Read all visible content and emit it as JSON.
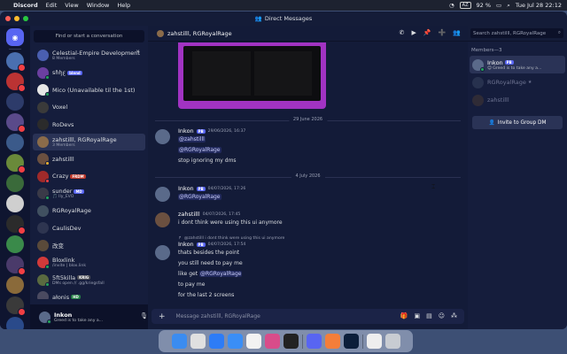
{
  "menubar": {
    "app": "Discord",
    "items": [
      "Edit",
      "View",
      "Window",
      "Help"
    ],
    "battery": "92 %",
    "input": "AZ",
    "datetime": "Tue Jul 28  22:12"
  },
  "window": {
    "title": "Direct Messages"
  },
  "dm_panel": {
    "search": "Find or start a conversation",
    "items": [
      {
        "name": "Celestial-Empire Development",
        "sub": "8 Members",
        "color": "#4a5fb0",
        "status": ""
      },
      {
        "name": "ꜱɦꜧꜫ",
        "tag": "blend",
        "sub": "",
        "color": "#6b3fa0",
        "status": "online"
      },
      {
        "name": "Mico (Unavailable til the 1st)",
        "sub": "",
        "color": "#e7e7e7",
        "status": "online"
      },
      {
        "name": "Voxel",
        "sub": "",
        "color": "#3a3a3a",
        "status": ""
      },
      {
        "name": "RoDevs",
        "sub": "",
        "color": "#2b2b2b",
        "status": ""
      },
      {
        "name": "zahstilll, RGRoyalRage",
        "sub": "3 Members",
        "color": "#8a6b4a",
        "status": ""
      },
      {
        "name": "zahstilll",
        "sub": "",
        "color": "#6b5040",
        "status": "idle"
      },
      {
        "name": "Crazy",
        "tag": "FRDM",
        "sub": "",
        "color": "#a02a2a",
        "status": "dnd"
      },
      {
        "name": "sunder",
        "tag": "MD",
        "sub": "🎵 lly_EVO",
        "color": "#3a3a48",
        "status": "online"
      },
      {
        "name": "RGRoyalRage",
        "sub": "",
        "color": "#405060",
        "status": ""
      },
      {
        "name": "CaulisDev",
        "sub": "",
        "color": "#2e3550",
        "status": ""
      },
      {
        "name": "改变",
        "sub": "",
        "color": "#5a4a3a",
        "status": ""
      },
      {
        "name": "Bloxlink",
        "sub": "/invite | blox.link",
        "color": "#d23a3a",
        "status": "online"
      },
      {
        "name": "5ft5killa",
        "tag": "KRIG",
        "sub": "DMs open // .gg/kriegsfall",
        "color": "#5a6a40",
        "status": "online"
      },
      {
        "name": "ałonis",
        "tag": "HD",
        "sub": "",
        "color": "#4a4a60",
        "status": "dnd"
      }
    ]
  },
  "user": {
    "name": "Inkon",
    "status": "Greed is to take any a..."
  },
  "chat": {
    "title": "zahstilll, RGRoyalRage",
    "dividers": [
      "29 June 2026",
      "4 July 2026"
    ],
    "messages": [
      {
        "author": "Inkon",
        "tag": "PB",
        "time": "29/06/2026, 16:37",
        "lines": [
          "@zahstilll",
          "@RGRoyalRage",
          "stop ignoring my dms"
        ]
      },
      {
        "author": "Inkon",
        "tag": "PB",
        "time": "04/07/2026, 17:26",
        "lines": [
          "@RGRoyalRage"
        ]
      },
      {
        "author": "zahstilll",
        "time": "04/07/2026, 17:45",
        "lines": [
          "i dont think were using this ui anymore"
        ]
      },
      {
        "reply": "@zahstilll i dont think were using this ui anymore",
        "author": "Inkon",
        "tag": "PB",
        "time": "04/07/2026, 17:54",
        "lines": [
          "thats besides the point",
          "you still need to pay me",
          "like get @RGRoyalRage",
          "to pay me",
          "for the last 2 screens"
        ]
      }
    ],
    "composer_placeholder": "Message zahstilll, RGRoyalRage"
  },
  "members": {
    "search": "Search zahstilll, RGRoyalRage",
    "header": "Members—3",
    "list": [
      {
        "name": "Inkon",
        "tag": "PB",
        "sub": "😊 Greed is to take any a...",
        "active": true
      },
      {
        "name": "RGRoyalRage",
        "tag": "★",
        "sub": "",
        "active": false
      },
      {
        "name": "zahstilll",
        "tag": "",
        "sub": "",
        "active": false
      }
    ],
    "invite": "Invite to Group DM"
  }
}
